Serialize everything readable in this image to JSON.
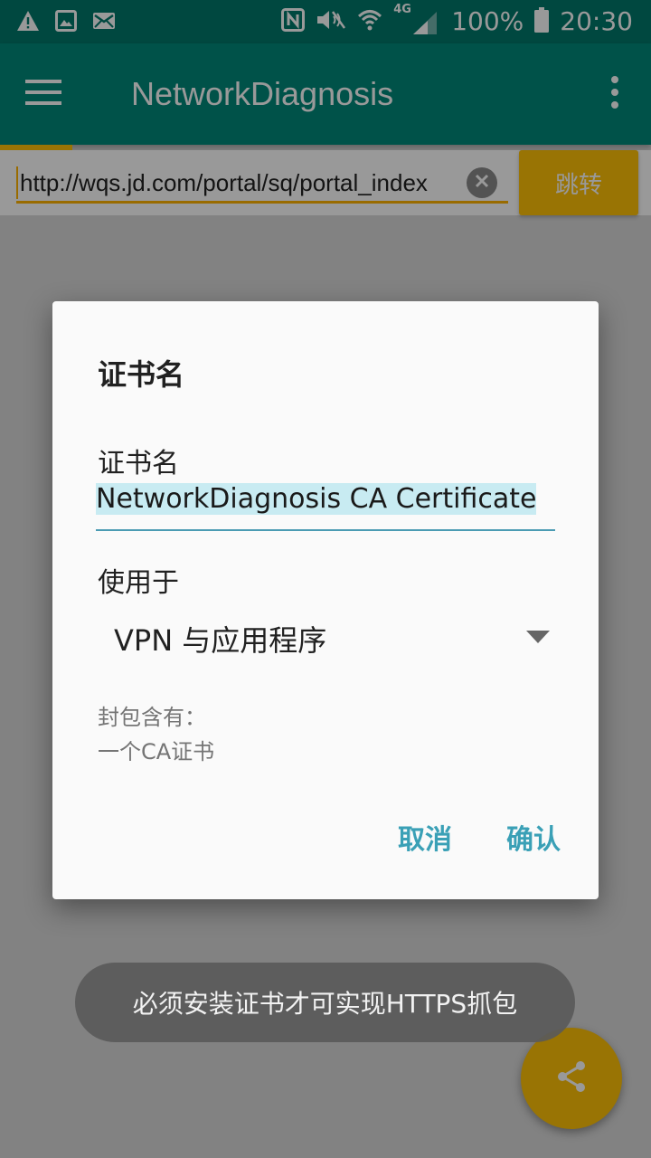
{
  "status_bar": {
    "icons_left": [
      "warning-icon",
      "image-icon",
      "mail-icon"
    ],
    "icons_right": [
      "nfc-icon",
      "mute-icon",
      "wifi-icon",
      "signal-4g-icon",
      "battery-icon"
    ],
    "network_label": "4G",
    "battery_text": "100%",
    "time": "20:30"
  },
  "app_bar": {
    "title": "NetworkDiagnosis",
    "menu_icon": "hamburger-menu-icon",
    "more_icon": "more-vert-icon"
  },
  "url_bar": {
    "value": "http://wqs.jd.com/portal/sq/portal_index",
    "go_label": "跳转"
  },
  "dialog": {
    "title": "证书名",
    "name_label": "证书名",
    "name_value": "NetworkDiagnosis CA Certificate",
    "use_label": "使用于",
    "use_value": "VPN 与应用程序",
    "package_label": "封包含有：",
    "package_value": "一个CA证书",
    "cancel_label": "取消",
    "ok_label": "确认"
  },
  "toast": {
    "message": "必须安装证书才可实现HTTPS抓包"
  },
  "fab": {
    "icon": "share-icon"
  },
  "colors": {
    "status_bar": "#00796b",
    "app_bar": "#00897b",
    "accent": "#ffc107",
    "dialog_button": "#3aa0b6"
  }
}
